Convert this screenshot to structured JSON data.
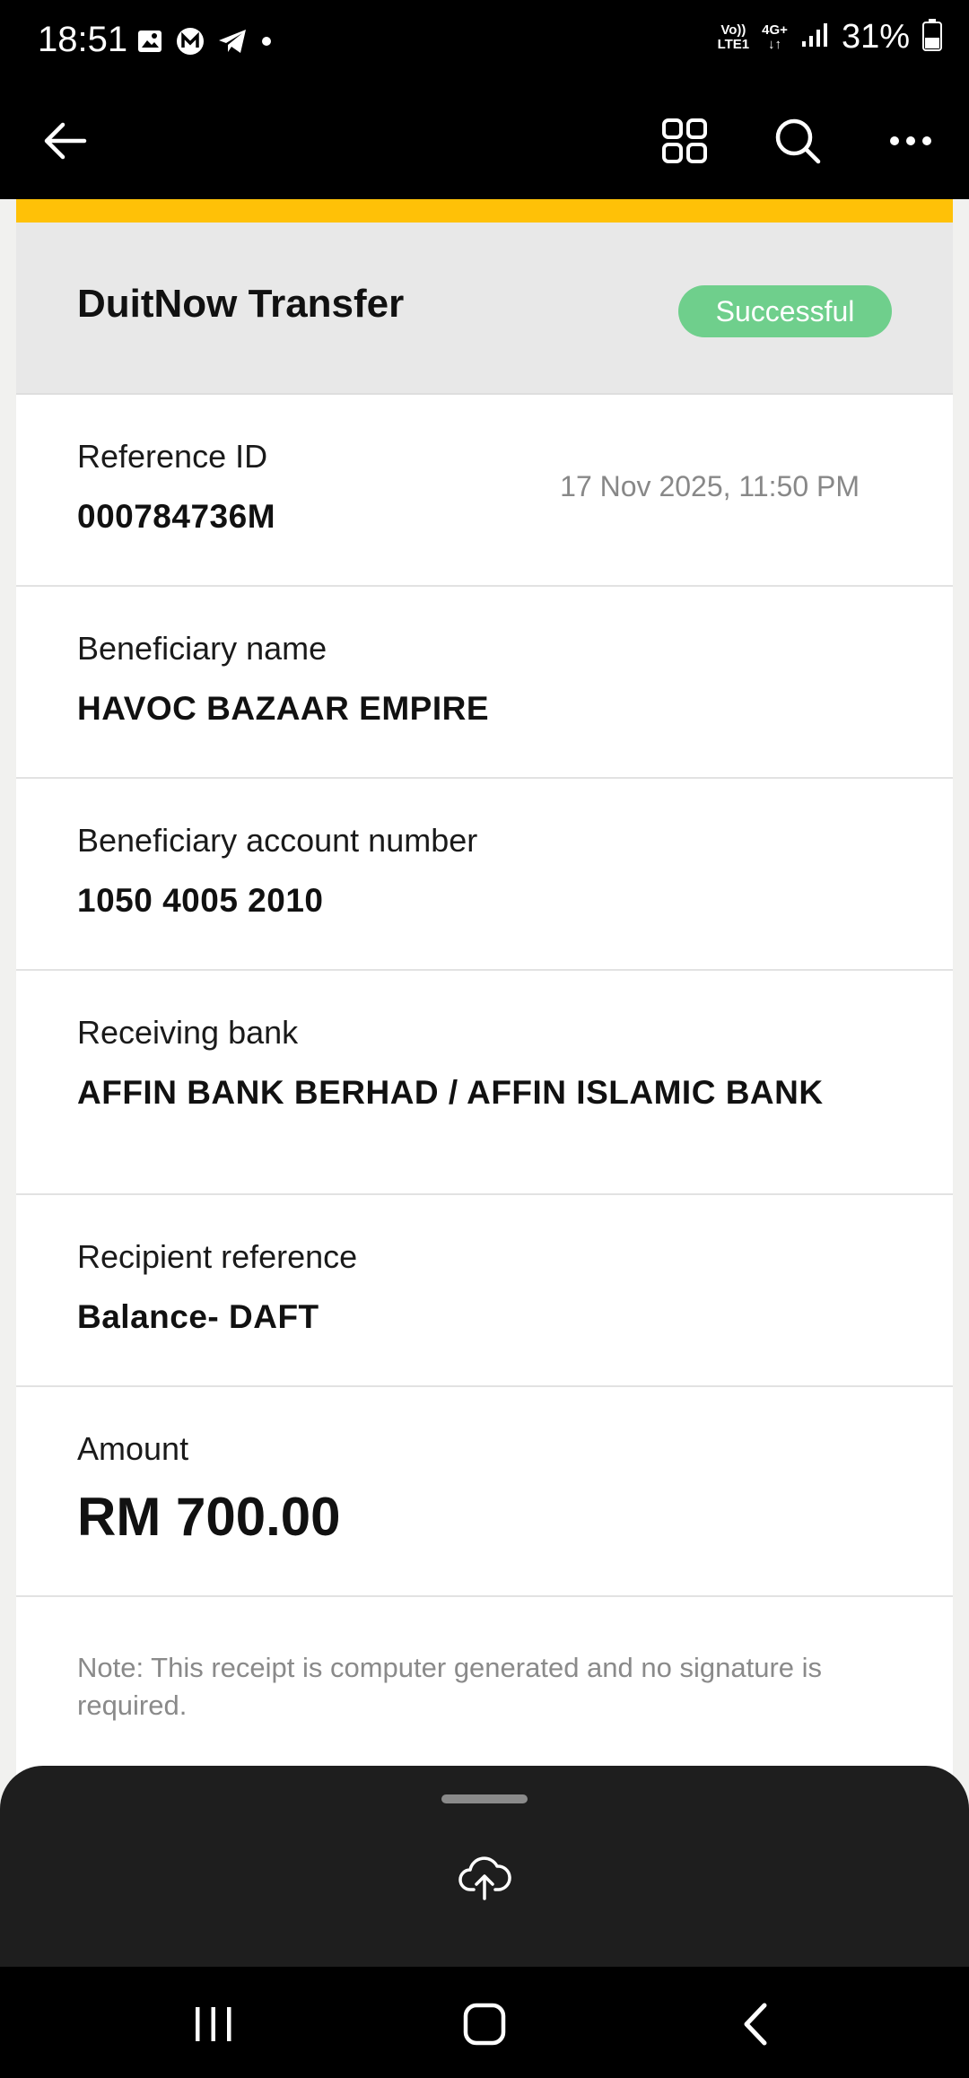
{
  "status_bar": {
    "time": "18:51",
    "network_top": "Vo))",
    "network_bottom": "LTE1",
    "data_type": "4G+",
    "battery": "31%"
  },
  "app_bar": {
    "icons": [
      "back-arrow-icon",
      "grid-icon",
      "search-icon",
      "more-icon"
    ]
  },
  "receipt": {
    "title": "DuitNow Transfer",
    "status": "Successful",
    "reference_label": "Reference ID",
    "reference_value": "000784736M",
    "datetime": "17 Nov 2025, 11:50 PM",
    "beneficiary_label": "Beneficiary name",
    "beneficiary_value": "HAVOC BAZAAR EMPIRE",
    "account_label": "Beneficiary account number",
    "account_value": "1050 4005 2010",
    "bank_label": "Receiving bank",
    "bank_value": "AFFIN BANK BERHAD / AFFIN ISLAMIC BANK",
    "recipient_ref_label": "Recipient reference",
    "recipient_ref_value": "Balance- DAFT",
    "amount_label": "Amount",
    "amount_value": "RM 700.00",
    "note": "Note: This receipt is computer generated and no signature is required."
  },
  "colors": {
    "accent": "#ffc107",
    "success": "#6fcf8c"
  }
}
